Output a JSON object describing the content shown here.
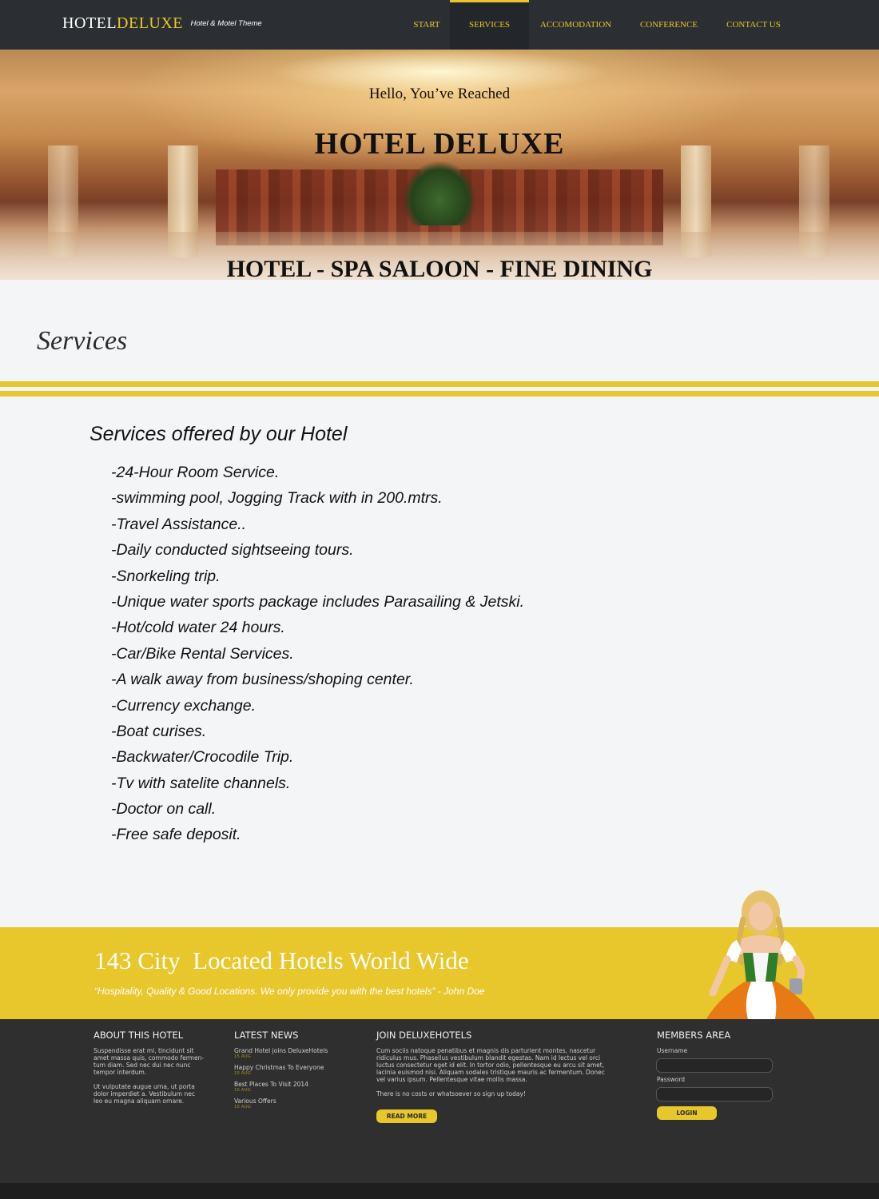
{
  "header": {
    "logo_part1": "HOTEL",
    "logo_part2": "DELUXE",
    "tagline": "Hotel & Motel Theme",
    "nav": [
      {
        "label": "START"
      },
      {
        "label": "SERVICES",
        "active": true
      },
      {
        "label": "ACCOMODATION"
      },
      {
        "label": "CONFERENCE"
      },
      {
        "label": "CONTACT US"
      }
    ]
  },
  "hero": {
    "greeting": "Hello, You’ve Reached",
    "title": "HOTEL DELUXE",
    "subtitle": "HOTEL - SPA SALOON - FINE DINING"
  },
  "page": {
    "heading": "Services"
  },
  "services": {
    "title": "Services offered by our Hotel",
    "items": [
      "-24-Hour Room Service.",
      "-swimming pool, Jogging Track with in 200.mtrs.",
      "-Travel Assistance..",
      "-Daily conducted sightseeing tours.",
      "-Snorkeling trip.",
      "-Unique water sports package includes Parasailing & Jetski.",
      "-Hot/cold water 24 hours.",
      "-Car/Bike Rental Services.",
      "-A walk away from business/shoping center.",
      "-Currency exchange.",
      "-Boat curises.",
      "-Backwater/Crocodile Trip.",
      "-Tv with satelite channels.",
      "-Doctor on call.",
      "-Free safe deposit."
    ]
  },
  "banner": {
    "title": "143 City  Located Hotels World Wide",
    "quote": "“Hospitality, Quality & Good Locations. We only provide you with the best hotels” - John Doe"
  },
  "footer": {
    "about": {
      "heading": "ABOUT THIS HOTEL",
      "para1": "Suspendisse erat mi, tincidunt sit\namet massa quis, commodo fermen-\ntum diam. Sed nec dui nec nunc\ntempor interdum.",
      "para2": " Ut vulputate augue urna, ut porta\ndolor imperdiet a. Vestibulum nec\nleo eu magna aliquam ornare."
    },
    "news": {
      "heading": "LATEST NEWS",
      "items": [
        {
          "title": "Grand Hotel joins DeluxeHotels",
          "date": "15 AUG"
        },
        {
          "title": "Happy Christmas To Everyone",
          "date": "15 AUG"
        },
        {
          "title": "Best Places To Visit 2014",
          "date": "15 AUG"
        },
        {
          "title": "Various Offers",
          "date": "15 AUG"
        }
      ]
    },
    "join": {
      "heading": "JOIN DELUXEHOTELS",
      "para1": "Cum sociis natoque penatibus et magnis dis parturient montes, nascetur\nridiculus mus. Phasellus vestibulum blandit egestas. Nam id lectus vel orci\nluctus consectetur eget id elit. In tortor odio, pellentesque eu arcu sit amet,\nlacinia euismod nisi. Aliquam sodales tristique mauris ac fermentum. Donec\nvel varius ipsum. Pellentesque vitae mollis massa.",
      "para2": "There is no costs or whatsoever so sign up today!",
      "button": "READ MORE"
    },
    "members": {
      "heading": "MEMBERS AREA",
      "username_label": "Username",
      "username_value": "",
      "password_label": "Password",
      "password_value": "",
      "button": "LOGIN"
    }
  },
  "colors": {
    "accent": "#e8c72c",
    "nav_bg": "#2b2e32",
    "footer_bg": "#2f2f2f"
  }
}
